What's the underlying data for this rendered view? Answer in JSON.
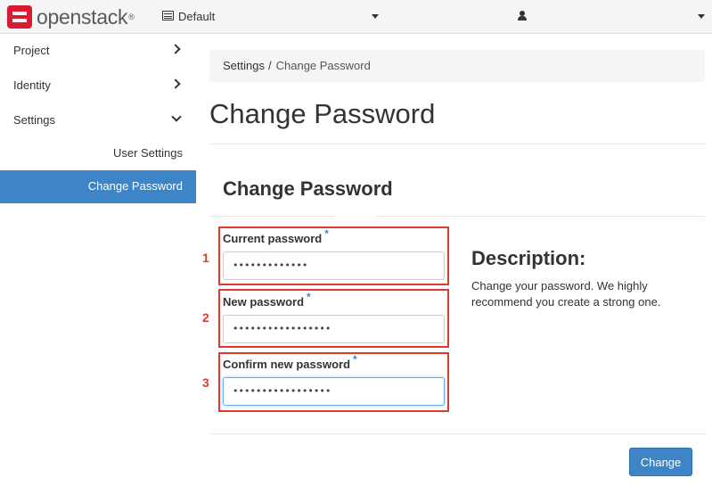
{
  "header": {
    "logo_text": "openstack",
    "logo_mark": "®",
    "project_label": "Default"
  },
  "sidebar": {
    "items": [
      {
        "label": "Project"
      },
      {
        "label": "Identity"
      },
      {
        "label": "Settings"
      }
    ],
    "sub_items": [
      {
        "label": "User Settings"
      },
      {
        "label": "Change Password"
      }
    ]
  },
  "breadcrumb": {
    "parent": "Settings",
    "separator": "/",
    "current": "Change Password"
  },
  "page": {
    "title": "Change Password",
    "modal_title": "Change Password"
  },
  "form": {
    "required_marker": "*",
    "fields": [
      {
        "number": "1",
        "label": "Current password",
        "value": "•••••••••••••"
      },
      {
        "number": "2",
        "label": "New password",
        "value": "•••••••••••••••••"
      },
      {
        "number": "3",
        "label": "Confirm new password",
        "value": "•••••••••••••••••"
      }
    ],
    "submit_label": "Change"
  },
  "description": {
    "title": "Description:",
    "text": "Change your password. We highly recommend you create a strong one."
  },
  "colors": {
    "accent": "#3e85c7",
    "annotation_red": "#e03a2e",
    "logo_red": "#da1a32"
  }
}
